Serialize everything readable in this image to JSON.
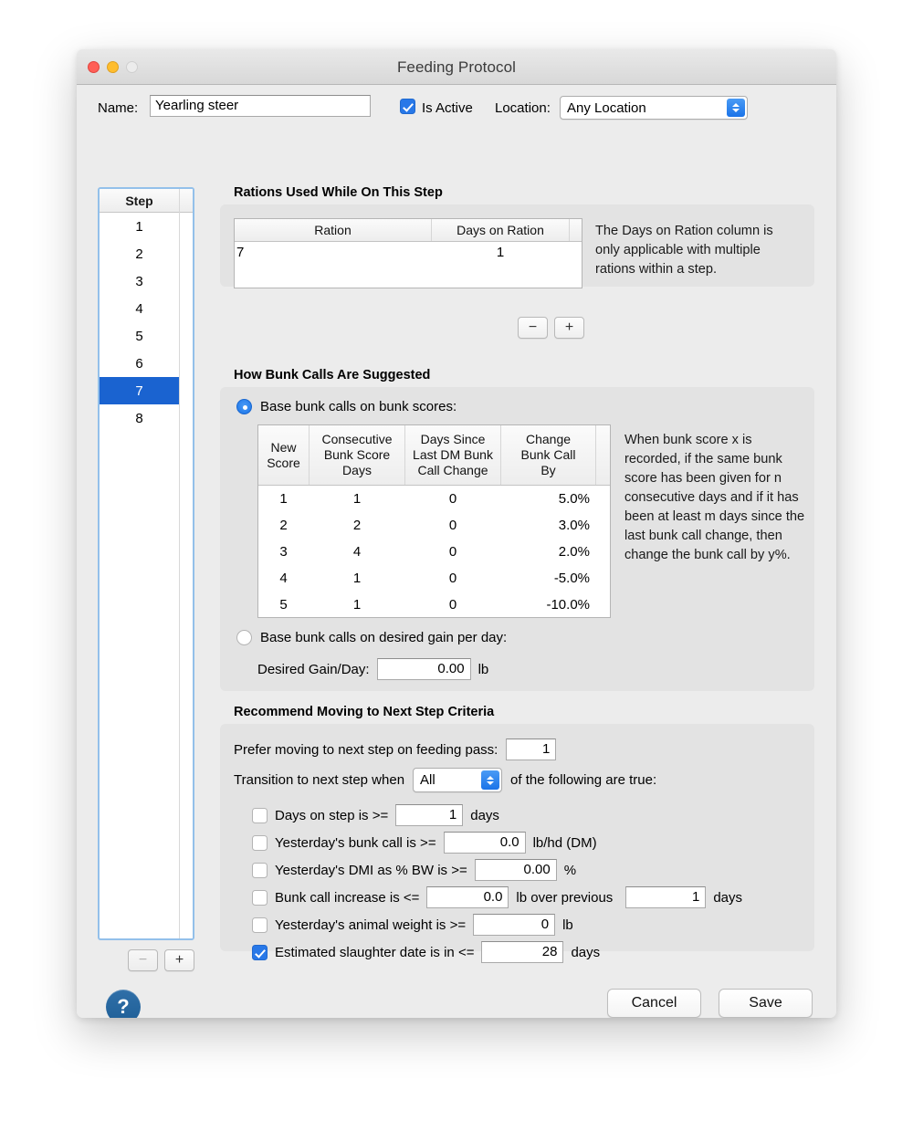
{
  "window": {
    "title": "Feeding Protocol",
    "traffic_lights": [
      "close-red",
      "minimize-yellow",
      "zoom-disabled"
    ]
  },
  "header": {
    "name_label": "Name:",
    "name_value": "Yearling steer",
    "is_active_label": "Is Active",
    "is_active_checked": true,
    "location_label": "Location:",
    "location_value": "Any Location"
  },
  "step_list": {
    "column_header": "Step",
    "steps": [
      "1",
      "2",
      "3",
      "4",
      "5",
      "6",
      "7",
      "8"
    ],
    "selected": "7",
    "remove_label": "−",
    "add_label": "+",
    "remove_enabled": false
  },
  "rations": {
    "section_title": "Rations Used While On This Step",
    "columns": [
      "Ration",
      "Days on Ration"
    ],
    "rows": [
      {
        "ration": "7",
        "days_on_ration": "1"
      }
    ],
    "hint": "The Days on Ration column is only applicable with multiple rations within a step.",
    "remove_label": "−",
    "add_label": "+"
  },
  "bunk_calls": {
    "section_title": "How Bunk Calls Are Suggested",
    "option_scores_label": "Base bunk calls on bunk scores:",
    "option_scores_selected": true,
    "table": {
      "columns": [
        "New\nScore",
        "Consecutive\nBunk Score\nDays",
        "Days Since\nLast DM Bunk\nCall Change",
        "Change\nBunk Call\nBy"
      ],
      "columns_lines": [
        [
          "New",
          "Score"
        ],
        [
          "Consecutive",
          "Bunk Score",
          "Days"
        ],
        [
          "Days Since",
          "Last DM Bunk",
          "Call Change"
        ],
        [
          "Change",
          "Bunk Call",
          "By"
        ]
      ],
      "rows": [
        {
          "new_score": "1",
          "consecutive_days": "1",
          "days_since": "0",
          "change_by": "5.0%"
        },
        {
          "new_score": "2",
          "consecutive_days": "2",
          "days_since": "0",
          "change_by": "3.0%"
        },
        {
          "new_score": "3",
          "consecutive_days": "4",
          "days_since": "0",
          "change_by": "2.0%"
        },
        {
          "new_score": "4",
          "consecutive_days": "1",
          "days_since": "0",
          "change_by": "-5.0%"
        },
        {
          "new_score": "5",
          "consecutive_days": "1",
          "days_since": "0",
          "change_by": "-10.0%"
        }
      ]
    },
    "hint": "When bunk score x is recorded, if the same bunk score has been given for n consecutive days and if it has been at least m days since the last bunk call change, then change the bunk call by y%.",
    "option_gain_label": "Base bunk calls on desired gain per day:",
    "option_gain_selected": false,
    "desired_gain_label": "Desired Gain/Day:",
    "desired_gain_value": "0.00",
    "desired_gain_unit": "lb"
  },
  "criteria": {
    "section_title": "Recommend Moving to Next Step Criteria",
    "feeding_pass_label": "Prefer moving to next step on feeding pass:",
    "feeding_pass_value": "1",
    "transition_prefix": "Transition to next step when",
    "transition_value": "All",
    "transition_suffix": "of the following are true:",
    "rows": [
      {
        "checked": false,
        "label": "Days on step is >=",
        "value": "1",
        "unit": "days",
        "value2": null,
        "unit2": null,
        "mid": null
      },
      {
        "checked": false,
        "label": "Yesterday's bunk call is >=",
        "value": "0.0",
        "unit": "lb/hd (DM)",
        "value2": null,
        "unit2": null,
        "mid": null
      },
      {
        "checked": false,
        "label": "Yesterday's DMI as % BW is >=",
        "value": "0.00",
        "unit": "%",
        "value2": null,
        "unit2": null,
        "mid": null
      },
      {
        "checked": false,
        "label": "Bunk call increase is <=",
        "value": "0.0",
        "unit": "lb over previous",
        "value2": "1",
        "unit2": "days",
        "mid": "lb over previous"
      },
      {
        "checked": false,
        "label": "Yesterday's animal weight is >=",
        "value": "0",
        "unit": "lb",
        "value2": null,
        "unit2": null,
        "mid": null
      },
      {
        "checked": true,
        "label": "Estimated slaughter date is in <=",
        "value": "28",
        "unit": "days",
        "value2": null,
        "unit2": null,
        "mid": null
      }
    ]
  },
  "footer": {
    "help_label": "?",
    "cancel_label": "Cancel",
    "save_label": "Save"
  },
  "colors": {
    "accent_blue": "#1a73e8",
    "selection_blue": "#1a63d0",
    "window_bg": "#ececec",
    "group_bg": "#e3e3e3",
    "help_blue": "#2f6fa8"
  }
}
